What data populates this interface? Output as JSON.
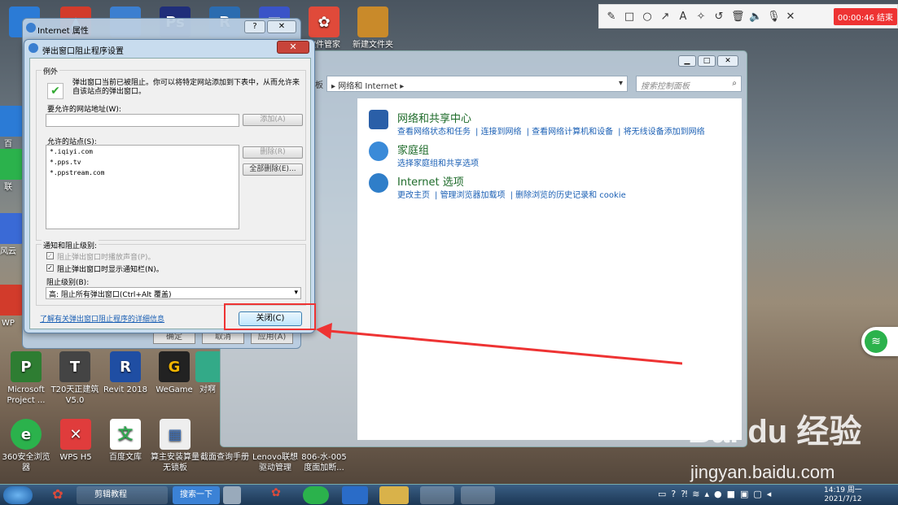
{
  "desktop": {
    "top_icons": [
      {
        "label": "",
        "color": "#2b7bd6"
      },
      {
        "label": "",
        "color": "#d23b2b"
      },
      {
        "label": "",
        "color": "#3c7fd0"
      },
      {
        "label": "",
        "color": "#1f2e7a"
      },
      {
        "label": "",
        "color": "#2b6cb0"
      },
      {
        "label": "",
        "color": "#3a54c8"
      },
      {
        "label": "软件管家",
        "color": "#e04a3a"
      },
      {
        "label": "新建文件夹",
        "color": "#c98a2a"
      }
    ],
    "left_partial": [
      "百",
      "联",
      "风云",
      "WP"
    ],
    "row1": [
      {
        "label": "Microsoft Project ...",
        "color": "#2e7d32",
        "letter": "P"
      },
      {
        "label": "T20天正建筑 V5.0",
        "color": "#444",
        "letter": "T"
      },
      {
        "label": "Revit 2018",
        "color": "#1f4ea3",
        "letter": "R"
      },
      {
        "label": "WeGame",
        "color": "#f0b400",
        "letter": "G"
      },
      {
        "label": "对啊",
        "color": "#3a8",
        "letter": ""
      }
    ],
    "row2": [
      {
        "label": "360安全浏览器",
        "color": "#2bb24c",
        "letter": "e"
      },
      {
        "label": "WPS H5",
        "color": "#e03c3c",
        "letter": "✕"
      },
      {
        "label": "百度文库",
        "color": "#2ea84f",
        "letter": "文"
      },
      {
        "label": "算主安装算量无锁板",
        "color": "#3b6db5",
        "letter": "▦"
      },
      {
        "label": "截面查询手册",
        "color": "#6a3fa0",
        "letter": ""
      },
      {
        "label": "Lenovo联想驱动管理",
        "color": "#3a6",
        "letter": ""
      },
      {
        "label": "806-水-005度面加断...",
        "color": "#777",
        "letter": ""
      }
    ]
  },
  "toolbar": {
    "icons": [
      "pencil-icon",
      "square-icon",
      "circle-icon",
      "arrow-icon",
      "text-icon",
      "magic-icon",
      "undo-icon",
      "trash-icon",
      "speaker-icon",
      "mic-icon",
      "close-icon"
    ],
    "glyphs": [
      "✎",
      "□",
      "○",
      "↗",
      "A",
      "✧",
      "↺",
      "🗑",
      "🔈",
      "🎙",
      "✕"
    ],
    "time": "00:00:46 结束"
  },
  "cp": {
    "address": "▸ 网络和 Internet ▸",
    "addr_prefix": "板",
    "search_placeholder": "搜索控制面板",
    "categories": [
      {
        "title": "网络和共享中心",
        "links": [
          "查看网络状态和任务",
          "连接到网络",
          "查看网络计算机和设备",
          "将无线设备添加到网络"
        ]
      },
      {
        "title": "家庭组",
        "links": [
          "选择家庭组和共享选项"
        ]
      },
      {
        "title": "Internet 选项",
        "links": [
          "更改主页",
          "管理浏览器加载项",
          "删除浏览的历史记录和 cookie"
        ]
      }
    ]
  },
  "ie": {
    "title": "Internet 属性",
    "ok": "确定",
    "cancel": "取消",
    "apply": "应用(A)"
  },
  "popup": {
    "title": "弹出窗口阻止程序设置",
    "close_x": "✕",
    "exceptions_group": "例外",
    "description": "弹出窗口当前已被阻止。你可以将特定网站添加到下表中，从而允许来自该站点的弹出窗口。",
    "address_label": "要允许的网站地址(W):",
    "add_button": "添加(A)",
    "allowed_label": "允许的站点(S):",
    "sites": [
      "*.iqiyi.com",
      "*.pps.tv",
      "*.ppstream.com"
    ],
    "remove_button": "删除(R)",
    "remove_all_button": "全部删除(E)...",
    "notify_group": "通知和阻止级别:",
    "check_sound": "阻止弹出窗口时播放声音(P)。",
    "check_bar": "阻止弹出窗口时显示通知栏(N)。",
    "level_label": "阻止级别(B):",
    "level_value": "高: 阻止所有弹出窗口(Ctrl+Alt 覆盖)",
    "learn_link": "了解有关弹出窗口阻止程序的详细信息",
    "close_button": "关闭(C)"
  },
  "taskbar": {
    "items": [
      {
        "label": "剪辑教程",
        "color": "#2d6bb5"
      },
      {
        "label": "搜索一下",
        "color": "#3b82d6"
      }
    ],
    "time": "14:19 周一",
    "date": "2021/7/12"
  },
  "watermark": {
    "logo": "Bai du 经验",
    "url": "jingyan.baidu.com"
  }
}
